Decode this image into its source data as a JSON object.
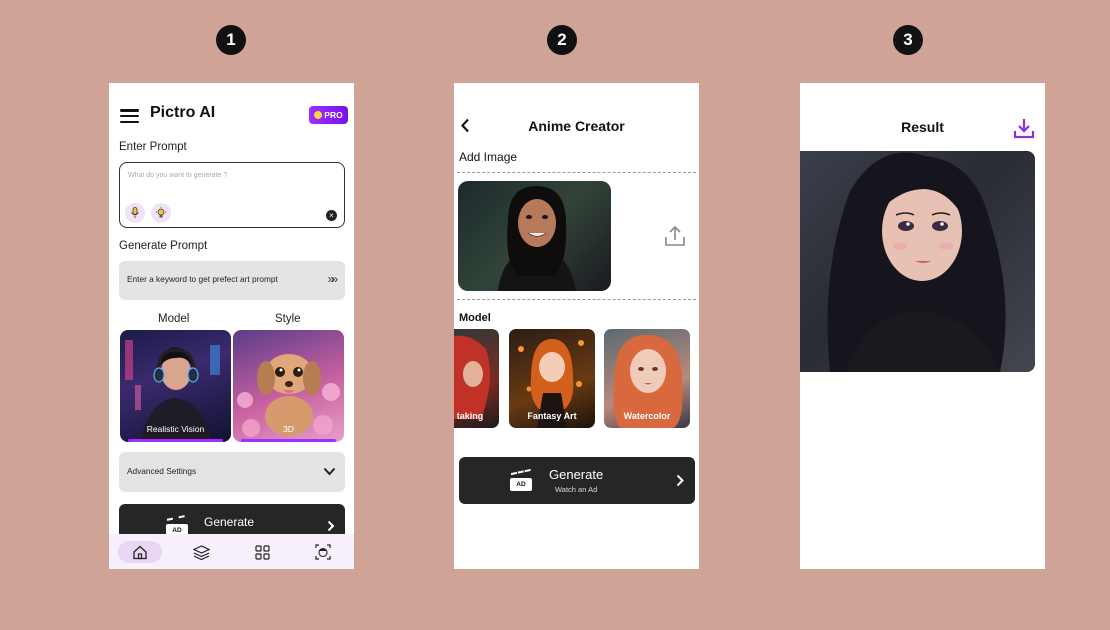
{
  "steps": [
    "1",
    "2",
    "3"
  ],
  "screen1": {
    "app_title": "Pictro AI",
    "pro_badge": "PRO",
    "enter_prompt_label": "Enter Prompt",
    "prompt_placeholder": "What do you want to generate ?",
    "generate_prompt_label": "Generate Prompt",
    "keyword_hint": "Enter a keyword to get prefect art prompt",
    "model_label": "Model",
    "style_label": "Style",
    "model_caption": "Realistic Vision",
    "style_caption": "3D",
    "advanced_settings": "Advanced Settings",
    "generate_button": "Generate",
    "ad_badge": "AD",
    "nav_items": [
      "home-icon",
      "layers-icon",
      "grid-icon",
      "face-scan-icon"
    ]
  },
  "screen2": {
    "title": "Anime Creator",
    "add_image_label": "Add Image",
    "model_label": "Model",
    "models": [
      "taking",
      "Fantasy Art",
      "Watercolor"
    ],
    "generate_button": "Generate",
    "generate_sub": "Watch an Ad",
    "ad_badge": "AD"
  },
  "screen3": {
    "title": "Result"
  },
  "colors": {
    "background": "#cfa396",
    "accent": "#9b30ff",
    "dark_button": "#262626"
  }
}
